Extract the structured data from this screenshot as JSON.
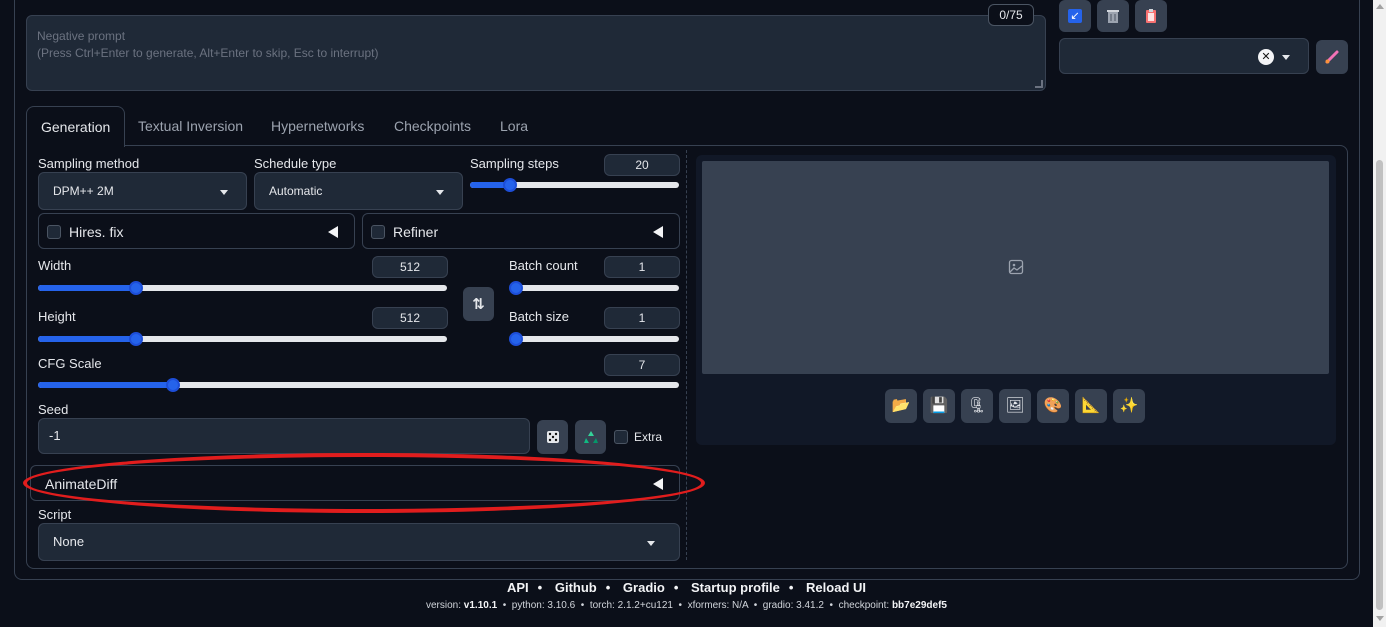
{
  "prompt": {
    "negative_placeholder_line1": "Negative prompt",
    "negative_placeholder_line2": "(Press Ctrl+Enter to generate, Alt+Enter to skip, Esc to interrupt)",
    "token_counter": "0/75"
  },
  "right_tools": {
    "style_clear": "✕"
  },
  "tabs": [
    {
      "label": "Generation"
    },
    {
      "label": "Textual Inversion"
    },
    {
      "label": "Hypernetworks"
    },
    {
      "label": "Checkpoints"
    },
    {
      "label": "Lora"
    }
  ],
  "generation": {
    "sampling_method_label": "Sampling method",
    "sampling_method_value": "DPM++ 2M",
    "schedule_type_label": "Schedule type",
    "schedule_type_value": "Automatic",
    "sampling_steps_label": "Sampling steps",
    "sampling_steps_value": "20",
    "sampling_steps_fraction": 0.19,
    "hires_fix_label": "Hires. fix",
    "refiner_label": "Refiner",
    "width_label": "Width",
    "width_value": "512",
    "width_fraction": 0.24,
    "height_label": "Height",
    "height_value": "512",
    "height_fraction": 0.24,
    "batch_count_label": "Batch count",
    "batch_count_value": "1",
    "batch_count_fraction": 0.0,
    "batch_size_label": "Batch size",
    "batch_size_value": "1",
    "batch_size_fraction": 0.0,
    "swap_icon": "⇅",
    "cfg_label": "CFG Scale",
    "cfg_value": "7",
    "cfg_fraction": 0.21,
    "seed_label": "Seed",
    "seed_value": "-1",
    "extra_label": "Extra",
    "animatediff_label": "AnimateDiff",
    "script_label": "Script",
    "script_value": "None"
  },
  "footer": {
    "links": [
      "API",
      "Github",
      "Gradio",
      "Startup profile",
      "Reload UI"
    ],
    "version_label": "version:",
    "version": "v1.10.1",
    "python_label": "python:",
    "python": "3.10.6",
    "torch_label": "torch:",
    "torch": "2.1.2+cu121",
    "xformers_label": "xformers:",
    "xformers": "N/A",
    "gradio_label": "gradio:",
    "gradio": "3.41.2",
    "checkpoint_label": "checkpoint:",
    "checkpoint": "bb7e29def5"
  },
  "colors": {
    "accent": "#2563eb",
    "highlight_ellipse": "#e11d1d",
    "background": "#0b0f19"
  }
}
